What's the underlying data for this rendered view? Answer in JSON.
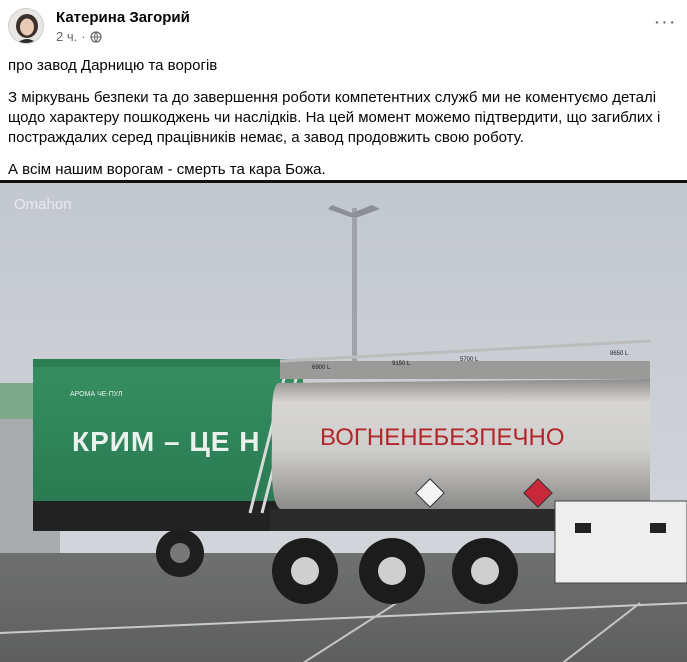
{
  "post": {
    "author": "Катерина Загорий",
    "time": "2 ч.",
    "more_label": "···",
    "paragraphs": [
      "про завод Дарницю та ворогів",
      "З міркувань безпеки та до завершення роботи компетентних служб ми не коментуємо деталі щодо характеру пошкоджень чи наслідків. На цей момент можемо підтвердити, що загиблих і постраждалих серед працівників немає, а завод продовжить свою роботу.",
      "А всім нашим ворогам - смерть та кара Божа."
    ]
  },
  "photo": {
    "watermark": "Оmahon",
    "trailer_brand": "АРОМА ЧЕ-ПУЛ",
    "trailer_text": "КРИМ – ЦЕ Н",
    "tank_text": "ВОГНЕНЕБЕЗПЕЧНО",
    "compartment_labels": [
      "6900 L",
      "9150 L",
      "5700 L",
      "8650 L"
    ],
    "colors": {
      "sky": "#c7ccd2",
      "trailer_green": "#2f8a5b",
      "tank": "#c9c8c6",
      "tank_text": "#b3262a",
      "asphalt": "#6e6f6f"
    }
  },
  "icons": {
    "globe": "globe-icon",
    "more": "more-options-icon"
  }
}
